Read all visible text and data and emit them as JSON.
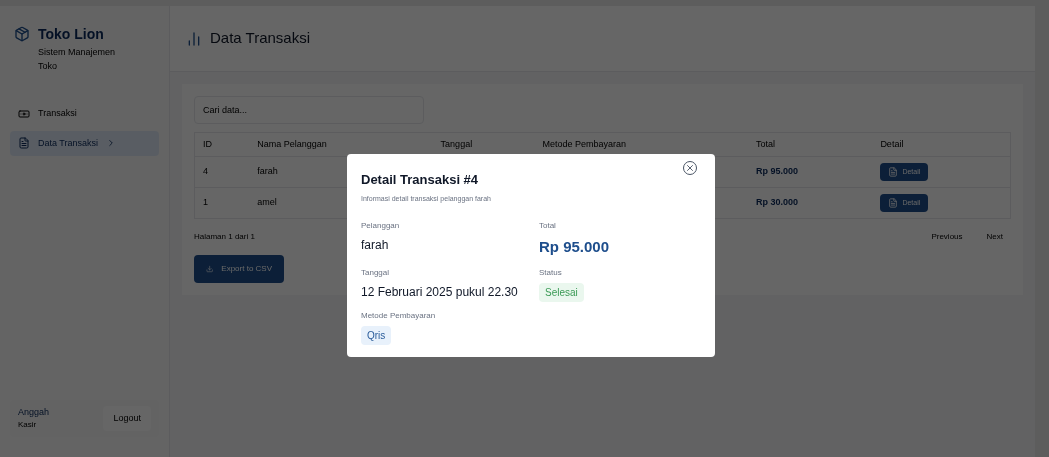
{
  "sidebar": {
    "brand": "Toko Lion",
    "subtitle": "Sistem Manajemen Toko",
    "items": [
      {
        "label": "Transaksi",
        "selected": false,
        "kind": "cash"
      },
      {
        "label": "Data Transaksi",
        "selected": true,
        "kind": "file"
      }
    ],
    "user": {
      "name": "Anggah",
      "role": "Kasir"
    },
    "logout": "Logout"
  },
  "header": {
    "title": "Data Transaksi"
  },
  "search": {
    "placeholder": "Cari data..."
  },
  "table": {
    "columns": [
      "ID",
      "Nama Pelanggan",
      "Tanggal",
      "Metode Pembayaran",
      "Total",
      "Detail"
    ],
    "rows": [
      {
        "id": "4",
        "name": "farah",
        "total": "Rp 95.000",
        "detail": "Detail"
      },
      {
        "id": "1",
        "name": "amel",
        "total": "Rp 30.000",
        "detail": "Detail"
      }
    ]
  },
  "pagination": {
    "info": "Halaman 1 dari 1",
    "previous": "Previous",
    "next": "Next"
  },
  "export": "Export to CSV",
  "modal": {
    "title": "Detail Transaksi #4",
    "description": "Informasi detail transaksi pelanggan farah",
    "fields": [
      {
        "label": "Pelanggan",
        "value": "farah",
        "kind": "text"
      },
      {
        "label": "Total",
        "value": "Rp 95.000",
        "kind": "amount"
      },
      {
        "label": "Tanggal",
        "value": "12 Februari 2025 pukul 22.30",
        "kind": "text"
      },
      {
        "label": "Status",
        "value": "Selesai",
        "kind": "status"
      },
      {
        "label": "Metode Pembayaran",
        "value": "Qris",
        "kind": "method"
      }
    ]
  }
}
